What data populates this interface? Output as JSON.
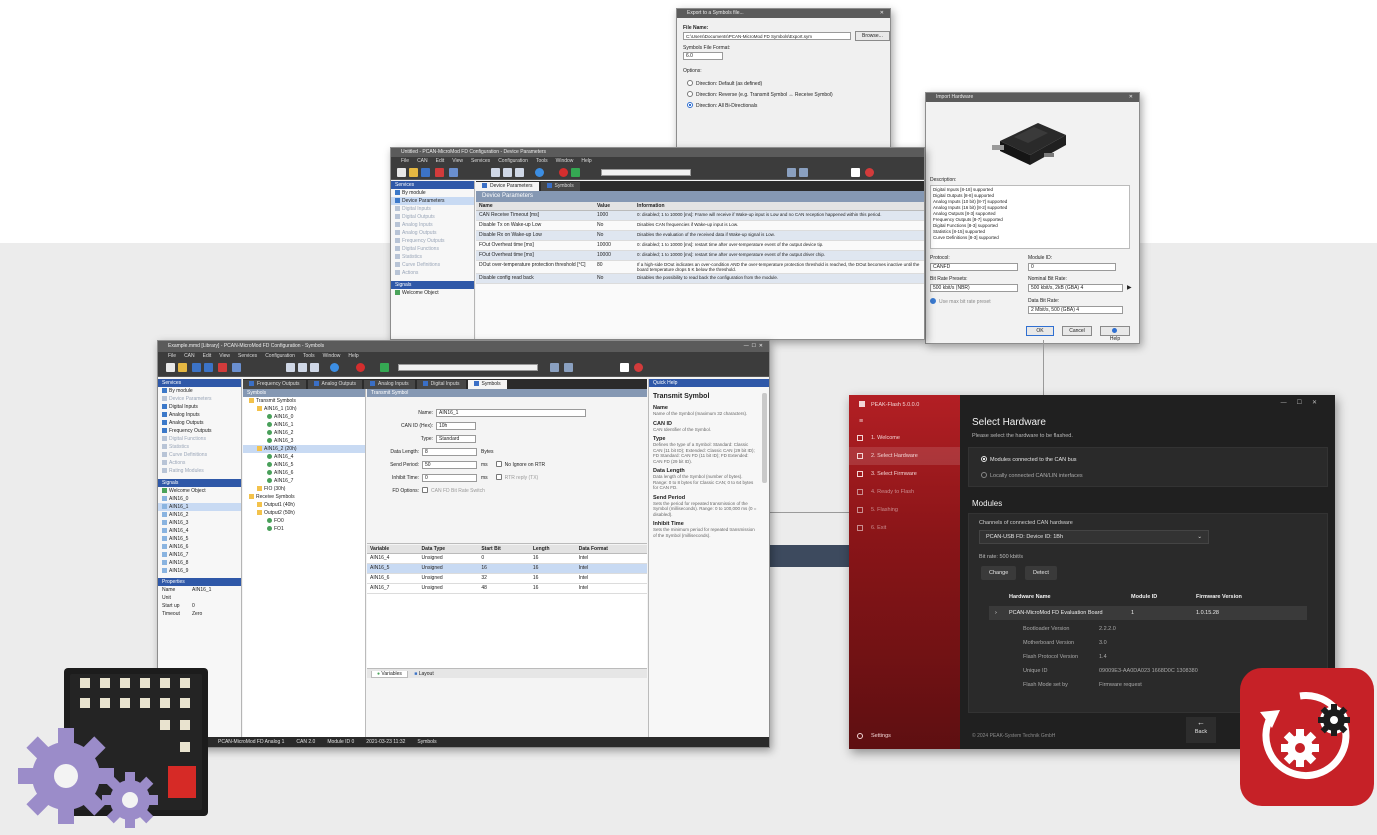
{
  "export_dialog": {
    "title": "Export to a Symbols file...",
    "file_name_label": "File Name:",
    "file_name_value": "C:\\Users\\Documents\\PCAN-MicroMod FD Symbols\\Export.sym",
    "browse_label": "Browse...",
    "format_label": "Symbols File Format:",
    "format_value": "6.0",
    "options_label": "Options:",
    "radio_1": "Direction: Default (as defined)",
    "radio_2": "Direction: Reverse (e.g. Transmit Symbol ↔ Receive Symbol)",
    "radio_3": "Direction: All Bi-Directionals"
  },
  "import_dialog": {
    "title": "Import Hardware",
    "description_label": "Description:",
    "features": [
      "Digital Inputs [8-18] supported",
      "Digital Outputs [8-8] supported",
      "Analog Inputs (10 bit) [8-7] supported",
      "Analog Inputs (16 bit) [8-2] supported",
      "Analog Outputs [8-3] supported",
      "Frequency Outputs [8-7] supported",
      "Digital Functions [8-3] supported",
      "Statistics [8-15] supported",
      "Curve Definitions [8-3] supported"
    ],
    "protocol_label": "Protocol:",
    "protocol_value": "CANFD",
    "module_id_label": "Module ID:",
    "module_id_value": "0",
    "bitrate_label": "Bit Rate Presets:",
    "bitrate_value": "500 kbit/s (NBR)",
    "nominal_label": "Nominal Bit Rate:",
    "nominal_value": "500 kbit/s, 2kB (GBA) 4",
    "use_label": "Use max bit rate preset",
    "data_label": "Data Bit Rate:",
    "data_value": "2 Mbit/s, 500 (GBA) 4",
    "ok": "OK",
    "cancel": "Cancel",
    "help": "Help"
  },
  "device_window": {
    "title": "Untitled - PCAN-MicroMod FD Configuration - Device Parameters",
    "menu": [
      "File",
      "CAN",
      "Edit",
      "View",
      "Services",
      "Configuration",
      "Tools",
      "Window",
      "Help"
    ],
    "panel_services": "Services",
    "tab_device_params": "Device Parameters",
    "tab_symbols": "Symbols",
    "section_title": "Device Parameters",
    "tree": [
      "By module",
      "Device Parameters",
      "Digital Inputs",
      "Digital Outputs",
      "Analog Inputs",
      "Analog Outputs",
      "Frequency Outputs",
      "Digital Functions",
      "Statistics",
      "Curve Definitions",
      "Actions"
    ],
    "panel_signals": "Signals",
    "signals_item": "Welcome Object",
    "table_headers": [
      "Name",
      "Value",
      "Information"
    ],
    "rows": [
      [
        "CAN Receive Timeout [ms]",
        "1000",
        "0: disabled; 1 to 10000 [ms]: Frame will receive if Wake-up input is Low and no CAN reception happened within this period."
      ],
      [
        "Disable Tx on Wake-up Low",
        "No",
        "Disables CAN frequencies if Wake-up input is Low."
      ],
      [
        "Disable Rx on Wake-up Low",
        "No",
        "Disables the evaluation of the received data if Wake-up signal is Low."
      ],
      [
        "FOut Overheat time [ms]",
        "10000",
        "0: disabled; 1 to 10000 [ms]: restart time after over-temperature event of the output device tip."
      ],
      [
        "FOut Overheat time [ms]",
        "10000",
        "0: disabled; 1 to 10000 [ms]: restart time after over-temperature event of the output driver chip."
      ],
      [
        "DOut over-temperature protection threshold [°C]",
        "80",
        "If a high-side DOut indicates an over-condition AND the over-temperature protection threshold is reached, the DOut becomes inactive until the board temperature drops 5 K below the threshold."
      ],
      [
        "Disable config read back",
        "No",
        "Disables the possibility to read back the configuration from the module."
      ]
    ]
  },
  "symbols_window": {
    "title": "Example.mmd [Library] - PCAN-MicroMod FD Configuration - Symbols",
    "menu": [
      "File",
      "CAN",
      "Edit",
      "View",
      "Services",
      "Configuration",
      "Tools",
      "Window",
      "Help"
    ],
    "tabs": [
      "Frequency Outputs",
      "Analog Outputs",
      "Analog Inputs",
      "Digital Inputs",
      "Symbols"
    ],
    "panel_services": "Services",
    "tree": [
      "By module",
      "Device Parameters",
      "Digital Inputs",
      "Analog Inputs",
      "Analog Outputs",
      "Frequency Outputs",
      "Digital Functions",
      "Statistics",
      "Curve Definitions",
      "Actions",
      "Rating Modules"
    ],
    "panel_signals": "Signals",
    "signals": [
      "Welcome Object",
      "AIN16_0",
      "AIN16_1",
      "AIN16_2",
      "AIN16_3",
      "AIN16_4",
      "AIN16_5",
      "AIN16_6",
      "AIN16_7",
      "AIN16_8",
      "AIN16_9"
    ],
    "panel_properties": "Properties",
    "props": [
      [
        "Name",
        "AIN16_1"
      ],
      [
        "Unit",
        ""
      ],
      [
        "Start up",
        "0"
      ],
      [
        "Timeout",
        "Zero"
      ]
    ],
    "symbols_head": "Symbols",
    "symbol_tree": [
      "Transmit Symbols",
      "AIN16_1 (10h)",
      "AIN16_0",
      "AIN16_1",
      "AIN16_2",
      "AIN16_3",
      "AIN16_2 (20h)",
      "AIN16_4",
      "AIN16_5",
      "AIN16_6",
      "AIN16_7",
      "FIO (30h)",
      "Receive Symbols",
      "Output1 (40h)",
      "Output2 (50h)",
      "FO0",
      "FO1"
    ],
    "editor_head": "Transmit Symbol",
    "fields": {
      "name_label": "Name:",
      "name_value": "AIN16_1",
      "canid_label": "CAN ID (Hex):",
      "canid_value": "10h",
      "type_label": "Type:",
      "type_value": "Standard",
      "len_label": "Data Length:",
      "len_value": "8",
      "len_unit": "Bytes",
      "period_label": "Send Period:",
      "period_value": "50",
      "period_unit": "ms",
      "rtr_label": "No Ignore on RTR",
      "inhibit_label": "Inhibit Time:",
      "inhibit_value": "0",
      "inhibit_unit": "ms",
      "rtr2_label": "RTR reply (TX)",
      "fd_label": "FD Options:",
      "fd_value": "CAN FD Bit Rate Switch"
    },
    "var_headers": [
      "Variable",
      "Data Type",
      "Start Bit",
      "Length",
      "Data Format"
    ],
    "vars": [
      [
        "AIN16_4",
        "Unsigned",
        "0",
        "16",
        "Intel"
      ],
      [
        "AIN16_5",
        "Unsigned",
        "16",
        "16",
        "Intel"
      ],
      [
        "AIN16_6",
        "Unsigned",
        "32",
        "16",
        "Intel"
      ],
      [
        "AIN16_7",
        "Unsigned",
        "48",
        "16",
        "Intel"
      ]
    ],
    "bottom_tabs": [
      "Variables",
      "Layout"
    ],
    "help_head": "Quick Help",
    "help_title": "Transmit Symbol",
    "help_sections": [
      [
        "Name",
        "Name of the Symbol (maximum 32 characters)."
      ],
      [
        "CAN ID",
        "CAN Identifier of the Symbol."
      ],
      [
        "Type",
        "Defines the type of a Symbol: Standard: Classic CAN (11 bit ID); Extended: Classic CAN (29 bit ID); FD Standard: CAN FD (11 bit ID); FD Extended: CAN FD (29 bit ID)."
      ],
      [
        "Data Length",
        "Data length of the Symbol (number of bytes). Range: 0 to 8 bytes for Classic CAN; 0 to 64 bytes for CAN FD."
      ],
      [
        "Send Period",
        "Sets the period for repeated transmission of the Symbol (milliseconds). Range: 0 to 100,000 ms (0 = disabled)."
      ],
      [
        "Inhibit Time",
        "Sets the minimum period for repeated transmission of the Symbol (milliseconds)."
      ]
    ],
    "status": [
      "PCAN-MicroMod FD Analog 1",
      "CAN 2.0",
      "Module ID 0",
      "2021-03-23 11:32",
      "Symbols"
    ]
  },
  "peak_window": {
    "app_name": "PEAK-Flash 5.0.0.0",
    "nav": [
      {
        "label": "1. Welcome",
        "state": "done"
      },
      {
        "label": "2. Select Hardware",
        "state": "active"
      },
      {
        "label": "3. Select Firmware",
        "state": "done"
      },
      {
        "label": "4. Ready to Flash",
        "state": "dim"
      },
      {
        "label": "5. Flashing",
        "state": "dim"
      },
      {
        "label": "6. Exit",
        "state": "dim"
      }
    ],
    "settings_label": "Settings",
    "footer": "© 2024 PEAK-System Technik GmbH",
    "heading": "Select Hardware",
    "subheading": "Please select the hardware to be flashed.",
    "option_can_bus": "Modules connected to the CAN bus",
    "option_local": "Locally connected CAN/LIN interfaces",
    "modules_heading": "Modules",
    "channels_label": "Channels of connected CAN hardware",
    "channel_value": "PCAN-USB FD: Device ID: 1Bh",
    "bitrate_text": "Bit rate: 500 kbit/s",
    "change_label": "Change",
    "detect_label": "Detect",
    "col_name": "Hardware Name",
    "col_module": "Module ID",
    "col_fw": "Firmware Version",
    "hw_name": "PCAN-MicroMod FD Evaluation Board",
    "hw_module": "1",
    "hw_fw": "1.0.15.28",
    "details": [
      [
        "Bootloader Version",
        "2.2.2.0"
      ],
      [
        "Motherboard Version",
        "3.0"
      ],
      [
        "Flash Protocol Version",
        "1.4"
      ],
      [
        "Unique ID",
        "09009E3-AA0DA023 1668D0C 1308380"
      ],
      [
        "Flash Mode set by",
        "Firmware request"
      ]
    ],
    "back_label": "Back",
    "accent": "#b31f24"
  },
  "app_icon_left": {
    "icon": "microcontroller-gears-icon"
  },
  "app_icon_right": {
    "icon": "gear-refresh-icon",
    "color": "#c62127"
  }
}
